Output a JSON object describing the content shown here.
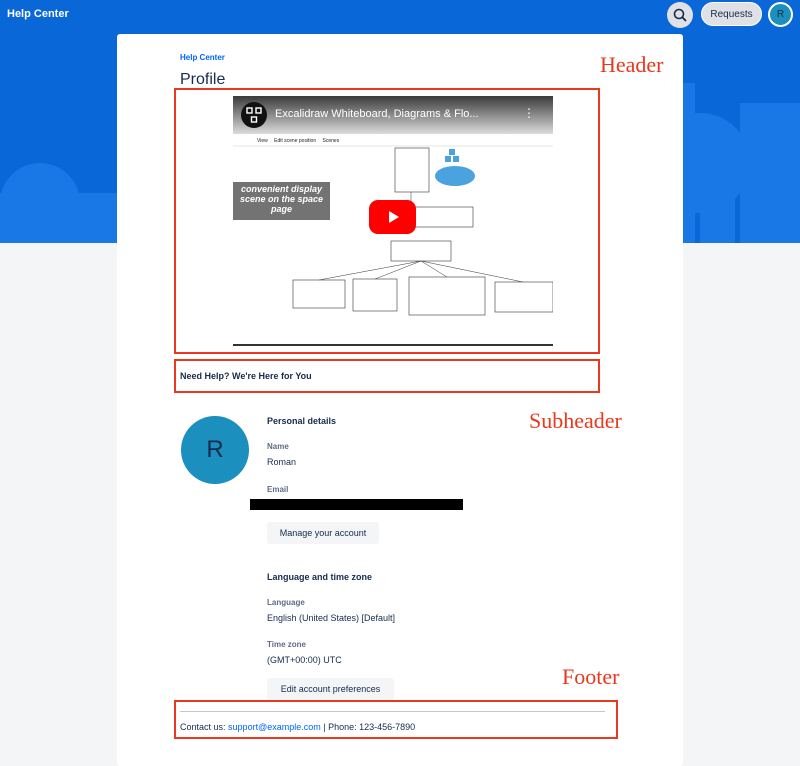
{
  "topbar": {
    "brand": "Help Center",
    "search_icon": "search-icon",
    "requests_label": "Requests",
    "avatar_initial": "R"
  },
  "breadcrumb": "Help Center",
  "page_title": "Profile",
  "video": {
    "title": "Excalidraw Whiteboard, Diagrams & Flo...",
    "overlay_text": "convenient display scene on the space page",
    "tabs": [
      "View",
      "Edit scene position",
      "Scenes"
    ],
    "play_icon": "play-icon"
  },
  "annotations": {
    "header": "Header",
    "subheader": "Subheader",
    "footer": "Footer"
  },
  "need_help": "Need Help? We're Here for You",
  "profile": {
    "avatar_initial": "R",
    "personal_details_title": "Personal details",
    "name_label": "Name",
    "name_value": "Roman",
    "email_label": "Email",
    "manage_account_label": "Manage your account",
    "language_section_title": "Language and time zone",
    "language_label": "Language",
    "language_value": "English (United States) [Default]",
    "timezone_label": "Time zone",
    "timezone_value": "(GMT+00:00) UTC",
    "edit_preferences_label": "Edit account preferences"
  },
  "footer": {
    "contact_prefix": "Contact us:",
    "email": "support@example.com",
    "phone_text": "| Phone: 123-456-7890"
  },
  "colors": {
    "brand_blue": "#0a67d8",
    "annotation_red": "#e8381e",
    "avatar": "#1b8fbe",
    "link": "#0065ff"
  }
}
